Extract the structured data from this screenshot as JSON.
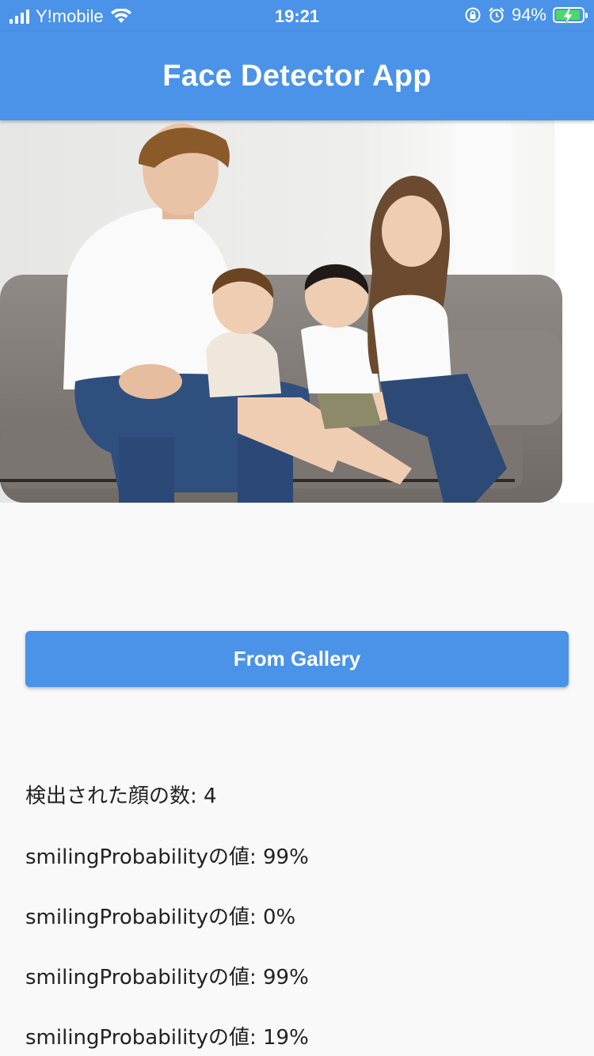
{
  "status_bar": {
    "carrier": "Y!mobile",
    "time": "19:21",
    "battery_percent": "94%",
    "battery_level": 0.94
  },
  "app_bar": {
    "title": "Face Detector App"
  },
  "photo": {
    "description_icon": "family-photo"
  },
  "actions": {
    "gallery_label": "From Gallery"
  },
  "results": {
    "face_count_text": "検出された顔の数: 4",
    "smiling": [
      "smilingProbabilityの値: 99%",
      "smilingProbabilityの値: 0%",
      "smilingProbabilityの値: 99%",
      "smilingProbabilityの値: 19%"
    ]
  },
  "colors": {
    "primary": "#4a93e8",
    "background": "#f9f9f9",
    "battery_fill": "#4cd964"
  }
}
